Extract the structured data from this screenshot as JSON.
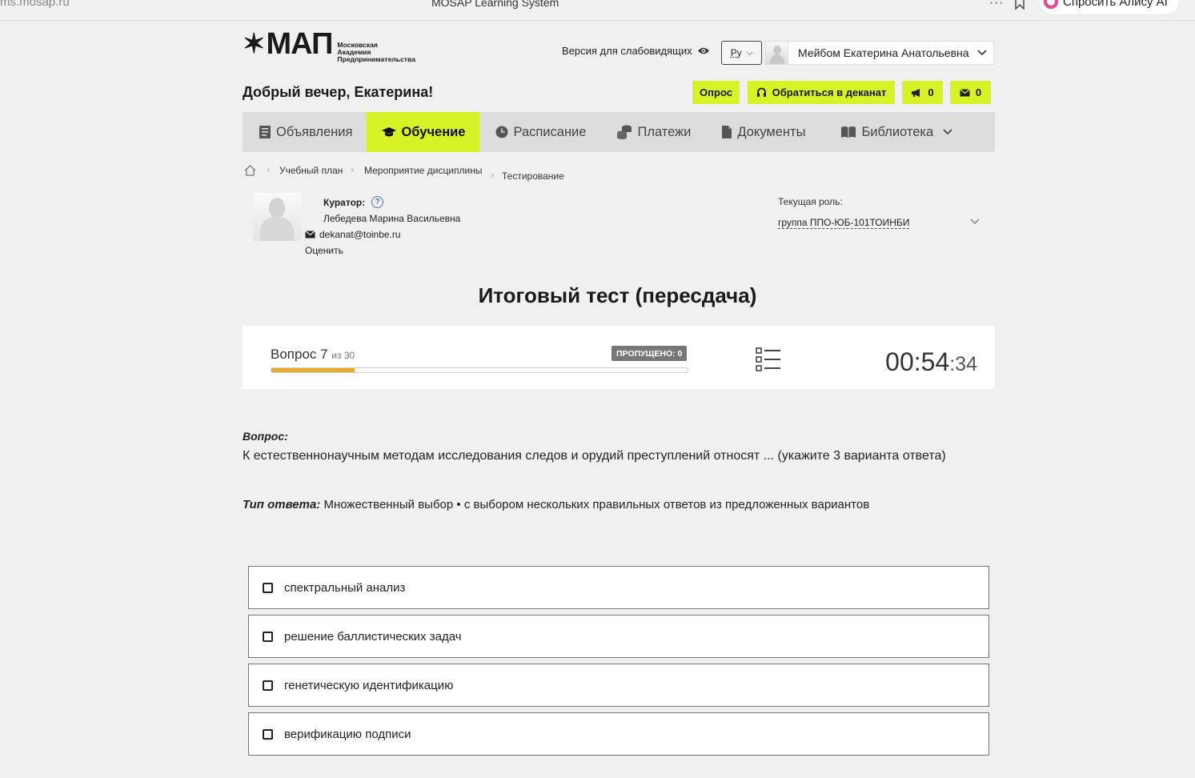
{
  "browser": {
    "url": "ms.mosap.ru",
    "title": "MOSAP Learning System",
    "more": "···",
    "alice_button": "Спросить Алису AI"
  },
  "header": {
    "logo_main": "МАП",
    "logo_sub": [
      "Московская",
      "Академия",
      "Предпринимательства"
    ],
    "vision_link": "Версия для слабовидящих",
    "language": "Ру",
    "user_name": "Мейбом Екатерина Анатольевна",
    "greeting": "Добрый вечер, Екатерина!",
    "survey_button": "Опрос",
    "deanery_button": "Обратиться в деканат",
    "announcements_count": "0",
    "messages_count": "0"
  },
  "nav": {
    "items": [
      {
        "label": "Объявления",
        "icon": "document-icon"
      },
      {
        "label": "Обучение",
        "icon": "graduation-cap-icon",
        "active": true
      },
      {
        "label": "Расписание",
        "icon": "clock-icon"
      },
      {
        "label": "Платежи",
        "icon": "coins-icon"
      },
      {
        "label": "Документы",
        "icon": "file-icon"
      },
      {
        "label": "Библиотека",
        "icon": "book-icon"
      }
    ]
  },
  "breadcrumb": [
    "Учебный план",
    "Мероприятие дисциплины",
    "Тестирование"
  ],
  "curator": {
    "label": "Куратор:",
    "name": "Лебедева Марина Васильевна",
    "email": "dekanat@toinbe.ru",
    "rate_link": "Оценить"
  },
  "role": {
    "label": "Текущая роль:",
    "value": "группа ППО-ЮБ-101ТОИНБИ"
  },
  "test": {
    "title": "Итоговый тест (пересдача)",
    "question_prefix": "Вопрос 7",
    "question_total": "из 30",
    "question_number": 7,
    "question_count": 30,
    "progress_fraction": 0.2,
    "skipped_badge": "ПРОПУЩЕНО: 0",
    "timer_main": "00:54",
    "timer_sec": ":34"
  },
  "question": {
    "label": "Вопрос:",
    "text": "К естественнонаучным методам исследования следов и орудий преступлений относят ... (укажите 3 варианта ответа)",
    "answer_type_label": "Тип ответа:",
    "answer_type_value": "Множественный выбор • с выбором нескольких правильных ответов из предложенных вариантов"
  },
  "options": [
    "спектральный анализ",
    "решение баллистических задач",
    "генетическую идентификацию",
    "верификацию подписи"
  ],
  "colors": {
    "accent": "#d7f226",
    "progress": "#e9a929",
    "background": "#f0f0f0"
  }
}
